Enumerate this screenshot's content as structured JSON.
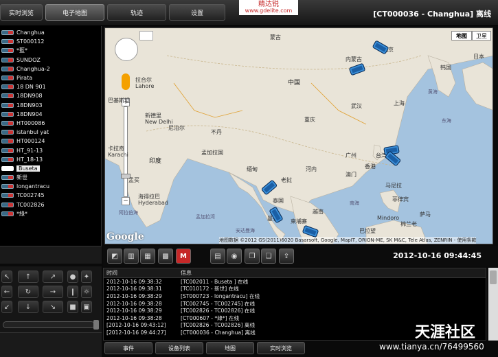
{
  "top_tabs": [
    "实时浏览",
    "电子地图",
    "轨迹",
    "设置"
  ],
  "logo": {
    "name": "精达锐",
    "url": "www.gdelite.com"
  },
  "window_title": "[CT000036 - Changhua] 离线",
  "vehicles": [
    "Changhua",
    "ST000112",
    "*藍*",
    "SUNDOZ",
    "Changhua-2",
    "Pirata",
    "18 DN 901",
    "18DN908",
    "18DN903",
    "18DN904",
    "HT000086",
    "istanbul yat",
    "HT000124",
    "HT_91-13",
    "HT_18-13",
    "Buseta",
    "新世",
    "longantracu",
    "TC002745",
    "TC002826",
    "*綠*"
  ],
  "map": {
    "type_buttons": [
      "地图",
      "卫星"
    ],
    "labels": {
      "china": "中国",
      "mongolia": "蒙古",
      "india": "印度",
      "pakistan": "巴基斯坦",
      "myanmar": "缅甸",
      "laos": "老挝",
      "thailand": "泰国",
      "vietnam": "越南",
      "cambodia": "柬埔寨",
      "bangladesh": "孟加拉国",
      "philippines": "菲律宾",
      "nepal": "尼泊尔",
      "bhutan": "不丹",
      "korea": "韩国",
      "japan": "日本",
      "taiwan": "台湾",
      "hongkong": "香港",
      "macau": "澳门",
      "beijing": "北京",
      "shanghai": "上海",
      "wuhan": "武汉",
      "guangzhou": "广州",
      "chongqing": "重庆",
      "delhi": "新德里",
      "karachi": "卡拉奇",
      "lahore": "拉合尔",
      "mumbai": "孟买",
      "hyderabad": "海得拉巴",
      "bangkok": "曼谷",
      "hanoi": "河内",
      "manila": "马尼拉",
      "delhi_en": "New Delhi",
      "hyderabad_en": "Hyderabad",
      "lahore_en": "Lahore",
      "karachi_en": "Karachi",
      "arabian_sea": "阿拉伯海",
      "bay_bengal": "孟加拉湾",
      "south_china_sea": "南海",
      "andaman": "安达曼海",
      "mindoro": "Mindoro",
      "mindanao": "棉兰老",
      "samar": "萨马",
      "borneo": "巴拉望",
      "yellow_sea": "黄海",
      "east_china_sea": "东海",
      "inner_mongolia": "内蒙古"
    },
    "copyright": "地图数据 ©2012 GS(2011)6020 Basarsoft, Google, MapIT, ORION-ME, SK M&C, Tele Atlas, ZENRIN - 使用条款",
    "google": "Google"
  },
  "toolbar_icons": [
    "select-area-icon",
    "split-view-icon",
    "grid-4-icon",
    "grid-9-icon",
    "marker-icon",
    "folder-icon",
    "camera-icon",
    "book-icon",
    "book-alt-icon",
    "export-icon"
  ],
  "toolbar_red_label": "M",
  "datetime": "2012-10-16 09:44:45",
  "event_log": {
    "headers": [
      "时间",
      "信息"
    ],
    "rows": [
      [
        "2012-10-16 09:38:32",
        "[TC002011 - Buseta ] 在线"
      ],
      [
        "2012-10-16 09:38:31",
        "[TC010172 - 新世] 在线"
      ],
      [
        "2012-10-16 09:38:29",
        "[ST000723 - longantracu] 在线"
      ],
      [
        "2012-10-16 09:38:28",
        "[TC002745 - TC002745] 在线"
      ],
      [
        "2012-10-16 09:38:29",
        "[TC002826 - TC002826] 在线"
      ],
      [
        "2012-10-16 09:38:28",
        "[CT000607 - *綠*] 在线"
      ],
      [
        "[2012-10-16 09:43:12]",
        "[TC002826 - TC002826] 离线"
      ],
      [
        "[2012-10-16 09:44:27]",
        "[CT000036 - Changhua] 离线"
      ]
    ]
  },
  "bottom_tabs": [
    "事件",
    "设备列表",
    "地图",
    "实时浏览"
  ],
  "watermark": {
    "text": "天涯社区",
    "url": "www.tianya.cn/76499560"
  }
}
